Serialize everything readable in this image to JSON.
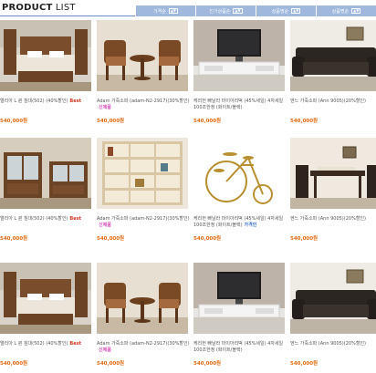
{
  "header": {
    "title_bold": "PRODUCT",
    "title_light": " LIST",
    "sort_tabs": [
      {
        "label": "가격순"
      },
      {
        "label": "인기상품순"
      },
      {
        "label": "상품명순"
      },
      {
        "label": "상품명순"
      }
    ]
  },
  "products": [
    {
      "name": "엘리아 L 퀸 침대(502) (40%할인)",
      "badge": "Best",
      "badge_style": "red",
      "price": "540,000원",
      "image": "bedroom"
    },
    {
      "name": "Adam 가죽소파 (adam-N2-2917)(30%할인)",
      "badge": "신제품",
      "badge_style": "pink",
      "price": "540,000원",
      "image": "chairs"
    },
    {
      "name": "케리헌 빠날라 마이아리떡 (45%세일) 4자세일 100조한정 (화이트/블랙)",
      "badge": "",
      "badge_style": "",
      "price": "540,000원",
      "image": "tv"
    },
    {
      "name": "엔느 가죽소파 (Ann 9005)(20%할인)",
      "badge": "",
      "badge_style": "",
      "price": "540,000원",
      "image": "sofa"
    },
    {
      "name": "엘리아 L 퀸 침대(502) (40%할인)",
      "badge": "Best",
      "badge_style": "red",
      "price": "540,000원",
      "image": "cabinet"
    },
    {
      "name": "Adam 가죽소파 (adam-N2-2917)(30%할인)",
      "badge": "신제품",
      "badge_style": "pink",
      "price": "540,000원",
      "image": "shelf"
    },
    {
      "name": "케리헌 빠날라 마이아리떡 (45%세일) 4자세일 100조한정 (화이트/블랙)",
      "badge": "가격인",
      "badge_style": "blue",
      "price": "540,000원",
      "image": "bicycle"
    },
    {
      "name": "엔느 가죽소파 (Ann 9005)(20%할인)",
      "badge": "",
      "badge_style": "",
      "price": "540,000원",
      "image": "dining"
    },
    {
      "name": "엘리아 L 퀸 침대(502) (40%할인)",
      "badge": "Best",
      "badge_style": "red",
      "price": "540,000원",
      "image": "bedroom"
    },
    {
      "name": "Adam 가죽소파 (adam-N2-2917)(30%할인)",
      "badge": "신제품",
      "badge_style": "pink",
      "price": "540,000원",
      "image": "chairs"
    },
    {
      "name": "케리헌 빠날라 마이아리떡 (45%세일) 4자세일 100조한정 (화이트/블랙)",
      "badge": "",
      "badge_style": "",
      "price": "540,000원",
      "image": "tv"
    },
    {
      "name": "엔느 가죽소파 (Ann 9005)(20%할인)",
      "badge": "",
      "badge_style": "",
      "price": "540,000원",
      "image": "sofa"
    }
  ]
}
